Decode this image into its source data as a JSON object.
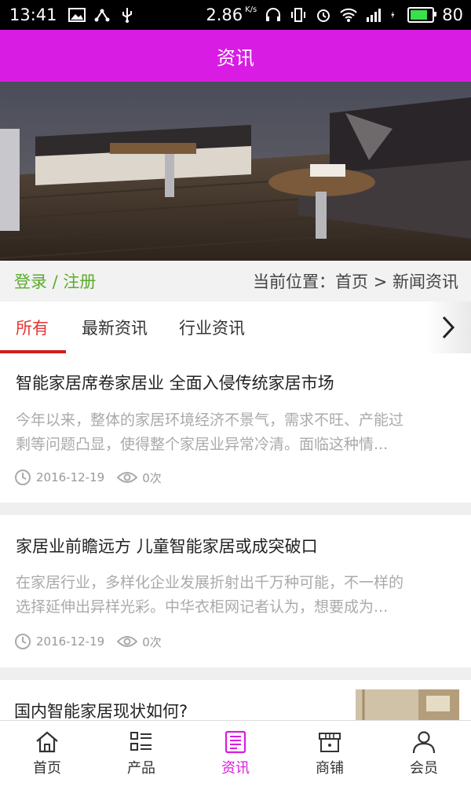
{
  "status_bar": {
    "time": "13:41",
    "speed": "2.86",
    "speed_unit": "K/s",
    "battery": "80",
    "battery_level": 0.8,
    "icons": [
      "image-icon",
      "usb-share-icon",
      "usb-icon",
      "headphones-icon",
      "vibrate-icon",
      "alarm-icon",
      "wifi-icon",
      "signal-4g-icon",
      "charging-icon",
      "battery-icon"
    ]
  },
  "header": {
    "title": "资讯"
  },
  "location_bar": {
    "login_label": "登录 / 注册",
    "crumb": "当前位置：首页 > 新闻资讯"
  },
  "tabs": [
    {
      "label": "所有",
      "active": true
    },
    {
      "label": "最新资讯",
      "active": false
    },
    {
      "label": "行业资讯",
      "active": false
    }
  ],
  "articles": [
    {
      "title": "智能家居席卷家居业 全面入侵传统家居市场",
      "summary_line1": "今年以来，整体的家居环境经济不景气，需求不旺、产能过",
      "summary_line2": "剩等问题凸显，使得整个家居业异常冷清。面临这种情...",
      "date": "2016-12-19",
      "views": "0次"
    },
    {
      "title": "家居业前瞻远方 儿童智能家居或成突破口",
      "summary_line1": "在家居行业，多样化企业发展折射出千万种可能，不一样的",
      "summary_line2": "选择延伸出异样光彩。中华衣柜网记者认为，想要成为...",
      "date": "2016-12-19",
      "views": "0次"
    },
    {
      "title": "国内智能家居现状如何?"
    }
  ],
  "bottom_nav": [
    {
      "label": "首页",
      "icon": "home-icon",
      "active": false
    },
    {
      "label": "产品",
      "icon": "grid-list-icon",
      "active": false
    },
    {
      "label": "资讯",
      "icon": "news-icon",
      "active": true
    },
    {
      "label": "商铺",
      "icon": "shop-icon",
      "active": false
    },
    {
      "label": "会员",
      "icon": "user-icon",
      "active": false
    }
  ],
  "colors": {
    "accent": "#d91ce3",
    "login_green": "#5cab2c",
    "active_tab": "#e53535"
  }
}
